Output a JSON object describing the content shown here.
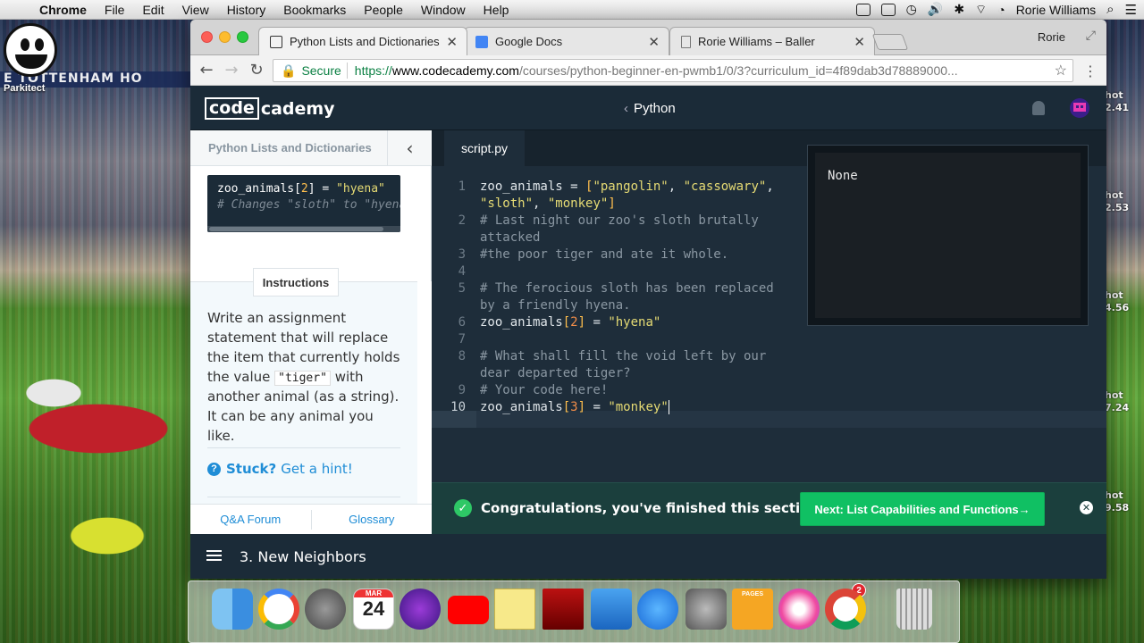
{
  "menubar": {
    "app_name": "Chrome",
    "menus": [
      "File",
      "Edit",
      "View",
      "History",
      "Bookmarks",
      "People",
      "Window",
      "Help"
    ],
    "user_name": "Rorie Williams"
  },
  "desktop": {
    "icon_label": "Parkitect",
    "banner_text": "E TOTTENHAM HO",
    "widgets": [
      {
        "top": "hot",
        "bottom": "2.41"
      },
      {
        "top": "hot",
        "bottom": "2.53"
      },
      {
        "top": "hot",
        "bottom": "4.56"
      },
      {
        "top": "hot",
        "bottom": "7.24"
      },
      {
        "top": "hot",
        "bottom": "9.58"
      }
    ]
  },
  "browser": {
    "tabs": [
      {
        "title": "Python Lists and Dictionaries",
        "icon": "codecademy-favicon",
        "active": true
      },
      {
        "title": "Google Docs",
        "icon": "google-docs-icon",
        "active": false
      },
      {
        "title": "Rorie Williams – Baller",
        "icon": "page-icon",
        "active": false
      }
    ],
    "profile_name": "Rorie",
    "address": {
      "secure_label": "Secure",
      "protocol": "https://",
      "domain": "www.codecademy.com",
      "path": "/courses/python-beginner-en-pwmb1/0/3?curriculum_id=4f89dab3d78889000..."
    }
  },
  "codecademy": {
    "logo_box": "code",
    "logo_rest": "cademy",
    "course_title": "Python",
    "left_panel": {
      "title": "Python Lists and Dictionaries",
      "snippet_line1_a": "zoo_animals[",
      "snippet_line1_b": "2",
      "snippet_line1_c": "] = ",
      "snippet_line1_d": "\"hyena\"",
      "snippet_line2": "# Changes \"sloth\" to \"hyena\"",
      "instructions_tab": "Instructions",
      "instructions_a": "Write an assignment statement that will replace the item that currently holds the value ",
      "instructions_code": "\"tiger\"",
      "instructions_b": " with another animal (as a string). It can be any animal you like.",
      "hint_stuck": "Stuck?",
      "hint_link": "Get a hint!",
      "footer_left": "Q&A Forum",
      "footer_right": "Glossary"
    },
    "editor": {
      "file_tab": "script.py",
      "output": "None"
    },
    "success": {
      "message": "Congratulations, you've finished this section!",
      "next_button": "Next: List Capabilities and Functions→"
    },
    "bottom": {
      "lesson": "3. New Neighbors"
    }
  },
  "dock": {
    "badge": "2",
    "calendar_month": "MAR",
    "calendar_day": "24",
    "pages_label": "PAGES"
  }
}
